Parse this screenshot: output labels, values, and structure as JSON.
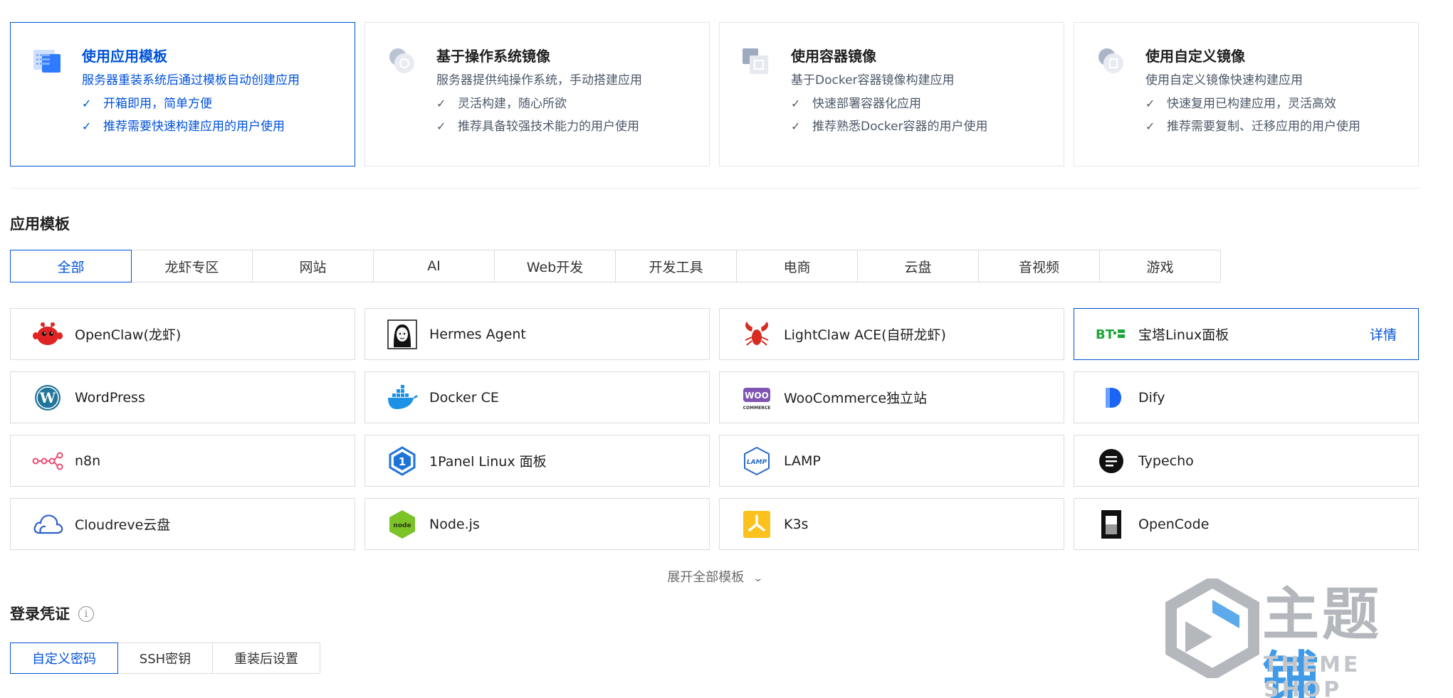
{
  "install_methods": [
    {
      "title": "使用应用模板",
      "desc": "服务器重装系统后通过模板自动创建应用",
      "features": [
        "开箱即用，简单方便",
        "推荐需要快速构建应用的用户使用"
      ],
      "icon": "app-template-icon",
      "active": true
    },
    {
      "title": "基于操作系统镜像",
      "desc": "服务器提供纯操作系统，手动搭建应用",
      "features": [
        "灵活构建，随心所欲",
        "推荐具备较强技术能力的用户使用"
      ],
      "icon": "os-image-icon",
      "active": false
    },
    {
      "title": "使用容器镜像",
      "desc": "基于Docker容器镜像构建应用",
      "features": [
        "快速部署容器化应用",
        "推荐熟悉Docker容器的用户使用"
      ],
      "icon": "container-image-icon",
      "active": false
    },
    {
      "title": "使用自定义镜像",
      "desc": "使用自定义镜像快速构建应用",
      "features": [
        "快速复用已构建应用，灵活高效",
        "推荐需要复制、迁移应用的用户使用"
      ],
      "icon": "custom-image-icon",
      "active": false
    }
  ],
  "app_templates": {
    "title": "应用模板",
    "tabs": [
      "全部",
      "龙虾专区",
      "网站",
      "AI",
      "Web开发",
      "开发工具",
      "电商",
      "云盘",
      "音视频",
      "游戏"
    ],
    "active_tab": "全部",
    "items": [
      {
        "name": "OpenClaw(龙虾)",
        "icon": "openclaw-icon"
      },
      {
        "name": "Hermes Agent",
        "icon": "hermes-agent-icon"
      },
      {
        "name": "LightClaw ACE(自研龙虾)",
        "icon": "lightclaw-icon"
      },
      {
        "name": "宝塔Linux面板",
        "icon": "bt-panel-icon",
        "detail": "详情",
        "active": true
      },
      {
        "name": "WordPress",
        "icon": "wordpress-icon"
      },
      {
        "name": "Docker CE",
        "icon": "docker-icon"
      },
      {
        "name": "WooCommerce独立站",
        "icon": "woocommerce-icon"
      },
      {
        "name": "Dify",
        "icon": "dify-icon"
      },
      {
        "name": "n8n",
        "icon": "n8n-icon"
      },
      {
        "name": "1Panel Linux 面板",
        "icon": "1panel-icon"
      },
      {
        "name": "LAMP",
        "icon": "lamp-icon"
      },
      {
        "name": "Typecho",
        "icon": "typecho-icon"
      },
      {
        "name": "Cloudreve云盘",
        "icon": "cloudreve-icon"
      },
      {
        "name": "Node.js",
        "icon": "nodejs-icon"
      },
      {
        "name": "K3s",
        "icon": "k3s-icon"
      },
      {
        "name": "OpenCode",
        "icon": "opencode-icon"
      }
    ],
    "expand_label": "展开全部模板"
  },
  "login": {
    "title": "登录凭证",
    "tabs": [
      "自定义密码",
      "SSH密钥",
      "重装后设置"
    ],
    "active_tab": "自定义密码"
  },
  "watermark": {
    "text_gray": "主题",
    "text_blue": "铺",
    "sub": "THEME SHOP"
  },
  "colors": {
    "accent": "#0052d9",
    "border": "#dcdcdc",
    "text_secondary": "#4e5969"
  }
}
